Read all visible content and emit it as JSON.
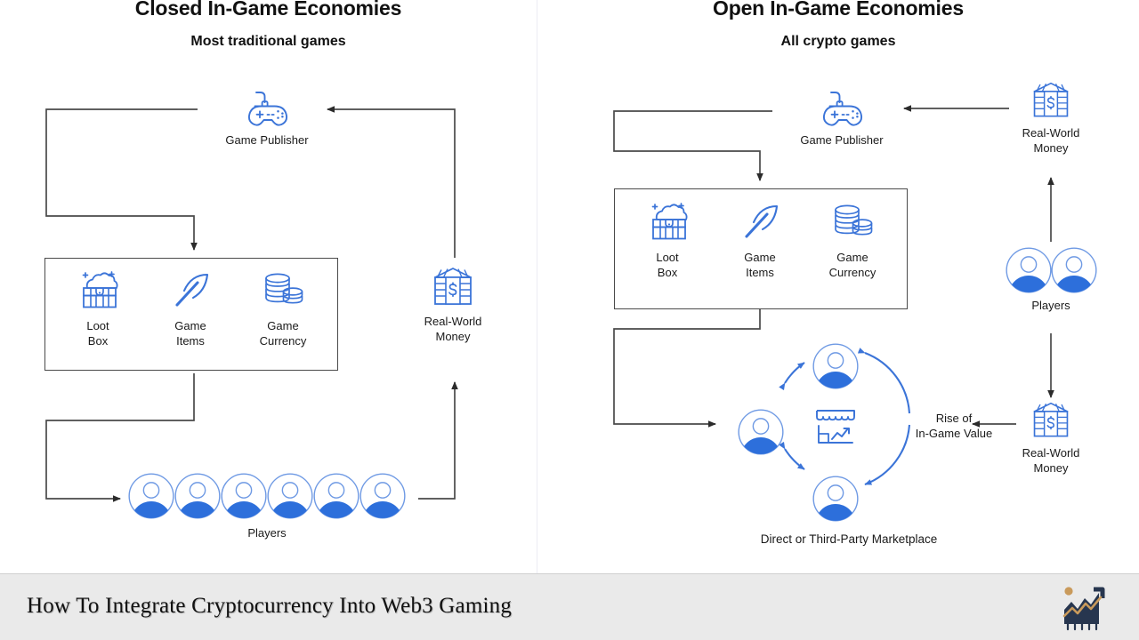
{
  "diagram": {
    "accent_color": "#2f6fdb",
    "line_color": "#4a4a4a",
    "panels": [
      {
        "id": "closed",
        "title": "Closed In-Game Economies",
        "subtitle": "Most traditional games",
        "publisher": {
          "label": "Game Publisher",
          "icon": "gamepad-icon"
        },
        "assets_box": [
          {
            "label": "Loot\nBox",
            "icon": "loot-box-icon"
          },
          {
            "label": "Game\nItems",
            "icon": "pickaxe-icon"
          },
          {
            "label": "Game\nCurrency",
            "icon": "coin-stack-icon"
          }
        ],
        "money": {
          "label": "Real-World\nMoney",
          "icon": "bank-dollar-icon"
        },
        "players": {
          "label": "Players",
          "icon": "avatar-icon",
          "count": 6
        }
      },
      {
        "id": "open",
        "title": "Open In-Game Economies",
        "subtitle": "All crypto games",
        "publisher": {
          "label": "Game Publisher",
          "icon": "gamepad-icon"
        },
        "assets_box": [
          {
            "label": "Loot\nBox",
            "icon": "loot-box-icon"
          },
          {
            "label": "Game\nItems",
            "icon": "pickaxe-icon"
          },
          {
            "label": "Game\nCurrency",
            "icon": "coin-stack-icon"
          }
        ],
        "money_top": {
          "label": "Real-World\nMoney",
          "icon": "bank-dollar-icon"
        },
        "money_bottom": {
          "label": "Real-World\nMoney",
          "icon": "bank-dollar-icon"
        },
        "players": {
          "label": "Players",
          "icon": "avatar-icon",
          "count": 2
        },
        "marketplace": {
          "center_icon": "storefront-chart-icon",
          "rise_label": "Rise of\nIn-Game Value",
          "caption": "Direct or Third-Party Marketplace",
          "avatar_count": 3
        }
      }
    ]
  },
  "banner": {
    "title": "How To Integrate Cryptocurrency Into Web3 Gaming",
    "logo_name": "growth-chart-logo",
    "bg_color": "#eaeaea",
    "logo_dark": "#27364f",
    "logo_gold": "#c99a5b"
  }
}
